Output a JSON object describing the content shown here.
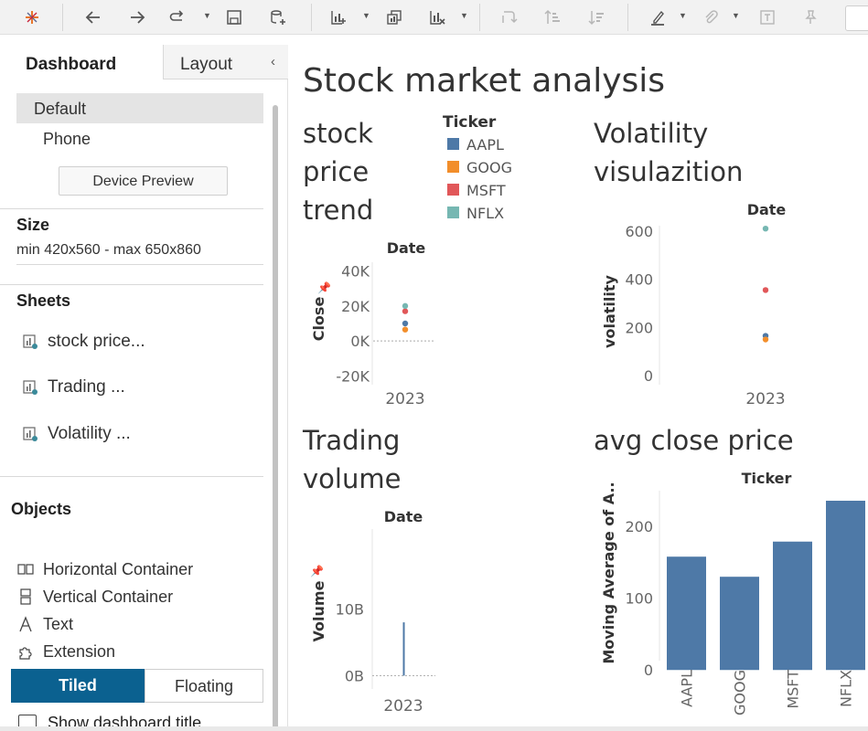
{
  "left_panel": {
    "tabs": [
      {
        "label": "Dashboard"
      },
      {
        "label": "Layout"
      }
    ],
    "devices": [
      {
        "label": "Default"
      },
      {
        "label": "Phone"
      }
    ],
    "device_preview_label": "Device Preview",
    "size": {
      "title": "Size",
      "value": "min 420x560 - max 650x860"
    },
    "sheets": {
      "title": "Sheets",
      "items": [
        {
          "label": "stock price..."
        },
        {
          "label": "Trading ..."
        },
        {
          "label": "Volatility ..."
        }
      ]
    },
    "objects": {
      "title": "Objects",
      "items": [
        {
          "label": "Horizontal Container",
          "icon": "horizontal-container-icon"
        },
        {
          "label": "Vertical Container",
          "icon": "vertical-container-icon"
        },
        {
          "label": "Text",
          "icon": "text-icon"
        },
        {
          "label": "Extension",
          "icon": "extension-icon"
        }
      ]
    },
    "layout_mode": {
      "tiled": "Tiled",
      "floating": "Floating"
    },
    "show_title_label": "Show dashboard title"
  },
  "dashboard": {
    "title": "Stock market analysis",
    "legend": {
      "title": "Ticker",
      "items": [
        {
          "label": "AAPL",
          "color": "#4e79a7"
        },
        {
          "label": "GOOG",
          "color": "#f28e2b"
        },
        {
          "label": "MSFT",
          "color": "#e15759"
        },
        {
          "label": "NFLX",
          "color": "#76b7b2"
        }
      ]
    }
  },
  "chart_data": [
    {
      "id": "stock-price-trend",
      "type": "scatter",
      "title_lines": [
        "stock",
        "price",
        "trend"
      ],
      "header": "Date",
      "xlabel": "",
      "ylabel": "Close",
      "x_ticks": [
        "2023"
      ],
      "y_ticks": [
        {
          "v": 40000,
          "label": "40K"
        },
        {
          "v": 20000,
          "label": "20K"
        },
        {
          "v": 0,
          "label": "0K"
        },
        {
          "v": -20000,
          "label": "-20K"
        }
      ],
      "ylim": [
        -25000,
        45000
      ],
      "series": [
        {
          "name": "AAPL",
          "values": [
            10000
          ]
        },
        {
          "name": "GOOG",
          "values": [
            6500
          ]
        },
        {
          "name": "MSFT",
          "values": [
            17000
          ]
        },
        {
          "name": "NFLX",
          "values": [
            20000
          ]
        }
      ]
    },
    {
      "id": "volatility",
      "type": "scatter",
      "title_lines": [
        "Volatility",
        "visulazition"
      ],
      "header": "Date",
      "xlabel": "",
      "ylabel": "volatility",
      "x_ticks": [
        "2023"
      ],
      "y_ticks": [
        {
          "v": 600,
          "label": "600"
        },
        {
          "v": 400,
          "label": "400"
        },
        {
          "v": 200,
          "label": "200"
        },
        {
          "v": 0,
          "label": "0"
        }
      ],
      "ylim": [
        -30,
        660
      ],
      "series": [
        {
          "name": "AAPL",
          "values": [
            165
          ]
        },
        {
          "name": "GOOG",
          "values": [
            150
          ]
        },
        {
          "name": "MSFT",
          "values": [
            355
          ]
        },
        {
          "name": "NFLX",
          "values": [
            610
          ]
        }
      ]
    },
    {
      "id": "trading-volume",
      "type": "bar",
      "title_lines": [
        "Trading",
        "volume"
      ],
      "header": "Date",
      "xlabel": "",
      "ylabel": "Volume",
      "x_ticks": [
        "2023"
      ],
      "y_ticks": [
        {
          "v": 10,
          "label": "10B"
        },
        {
          "v": 0,
          "label": "0B"
        }
      ],
      "ylim": [
        -2,
        22
      ],
      "values": [
        8
      ]
    },
    {
      "id": "avg-close-price",
      "type": "bar",
      "title_lines": [
        "avg close price"
      ],
      "header": "Ticker",
      "xlabel": "",
      "ylabel": "Moving Average of A..",
      "categories": [
        "AAPL",
        "GOOG",
        "MSFT",
        "NFLX"
      ],
      "values": [
        158,
        130,
        179,
        236
      ],
      "y_ticks": [
        {
          "v": 200,
          "label": "200"
        },
        {
          "v": 100,
          "label": "100"
        },
        {
          "v": 0,
          "label": "0"
        }
      ],
      "ylim": [
        -15,
        250
      ],
      "bar_color": "#4e79a7"
    }
  ]
}
